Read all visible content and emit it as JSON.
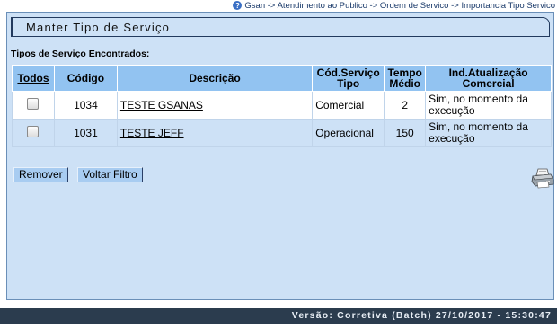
{
  "breadcrumb": {
    "text": "Gsan -> Atendimento ao Publico -> Ordem de Servico -> Importancia Tipo Servico"
  },
  "panel": {
    "title": "Manter Tipo de Serviço",
    "section_label": "Tipos de Serviço Encontrados:"
  },
  "table": {
    "headers": {
      "todos": "Todos",
      "codigo": "Código",
      "descricao": "Descrição",
      "cod_servico_l1": "Cód.Serviço",
      "cod_servico_l2": "Tipo",
      "tempo_l1": "Tempo",
      "tempo_l2": "Médio",
      "ind_l1": "Ind.Atualização",
      "ind_l2": "Comercial"
    },
    "rows": [
      {
        "codigo": "1034",
        "descricao": "TESTE GSANAS",
        "tipo": "Comercial",
        "tempo": "2",
        "ind": "Sim, no momento da execução"
      },
      {
        "codigo": "1031",
        "descricao": "TESTE JEFF",
        "tipo": "Operacional",
        "tempo": "150",
        "ind": "Sim, no momento da execução"
      }
    ]
  },
  "buttons": {
    "remover": "Remover",
    "voltar": "Voltar Filtro"
  },
  "footer": {
    "version": "Versão: Corretiva (Batch) 27/10/2017 - 15:30:47"
  },
  "icons": {
    "help": "help-icon",
    "printer": "printer-icon"
  }
}
